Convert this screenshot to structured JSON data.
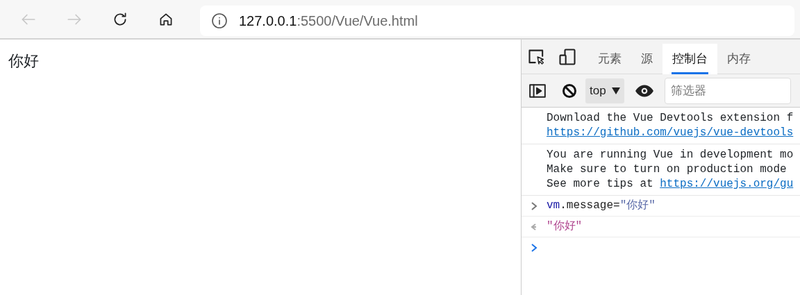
{
  "browser": {
    "back_disabled": true,
    "forward_disabled": true,
    "address": {
      "host": "127.0.0.1",
      "path": ":5500/Vue/Vue.html"
    }
  },
  "page": {
    "text": "你好"
  },
  "devtools": {
    "tabs": [
      {
        "label": "元素",
        "selected": false
      },
      {
        "label": "源",
        "selected": false
      },
      {
        "label": "控制台",
        "selected": true
      },
      {
        "label": "内存",
        "selected": false
      }
    ],
    "context": "top",
    "filter": {
      "placeholder": "筛选器"
    },
    "messages": [
      {
        "kind": "log",
        "lines": [
          {
            "text": "Download the Vue Devtools extension f"
          },
          {
            "link": "https://github.com/vuejs/vue-devtools"
          }
        ]
      },
      {
        "kind": "log",
        "lines": [
          {
            "text": "You are running Vue in development mo"
          },
          {
            "text": "Make sure to turn on production mode"
          },
          {
            "text": "See more tips at ",
            "link": "https://vuejs.org/gu"
          }
        ]
      },
      {
        "kind": "input",
        "object": "vm",
        "property": ".message=",
        "string": "\"你好\""
      },
      {
        "kind": "result",
        "string": "\"你好\""
      },
      {
        "kind": "prompt"
      }
    ]
  }
}
